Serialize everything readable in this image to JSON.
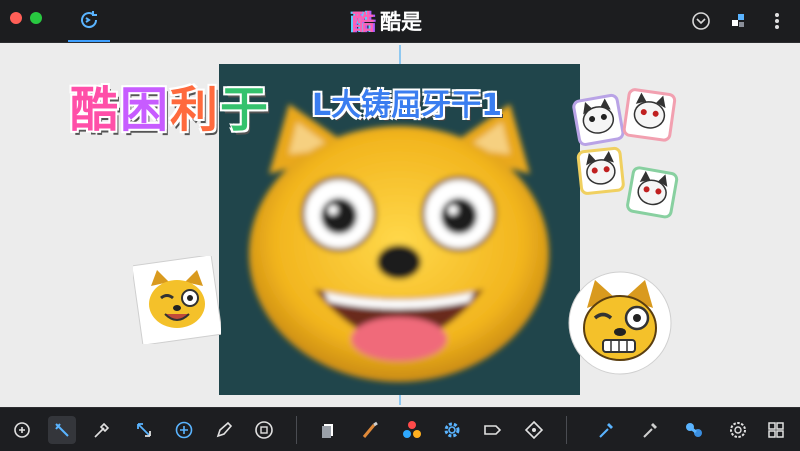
{
  "window": {
    "title_logo": "酷",
    "title": "酷是"
  },
  "canvas": {
    "headline_text": "酷困利于",
    "sub_text": "L大铸屈牙干1"
  },
  "colors": {
    "accent": "#3ea0ff",
    "titlebar_bg": "#1c1d1f",
    "toolbar_bg": "#1d1e21",
    "canvas_bg": "#ececec",
    "image_bg": "#20454b",
    "face_yellow": "#f4c12a"
  },
  "icons": {
    "titlebar": [
      "refresh-icon",
      "compass-icon",
      "blocks-icon",
      "more-vertical-icon"
    ],
    "toolbar": [
      "rotate-icon",
      "magic-wand-icon",
      "eyedropper-icon",
      "crop-transform-icon",
      "add-circle-icon",
      "pen-icon",
      "save-icon",
      "layers-icon",
      "brush-icon",
      "color-dots-icon",
      "settings-gear-icon",
      "tag-icon",
      "target-icon",
      "dropper-blue-icon",
      "dropper-gray-icon",
      "blob-brush-icon",
      "badge-icon",
      "expand-icon"
    ]
  }
}
